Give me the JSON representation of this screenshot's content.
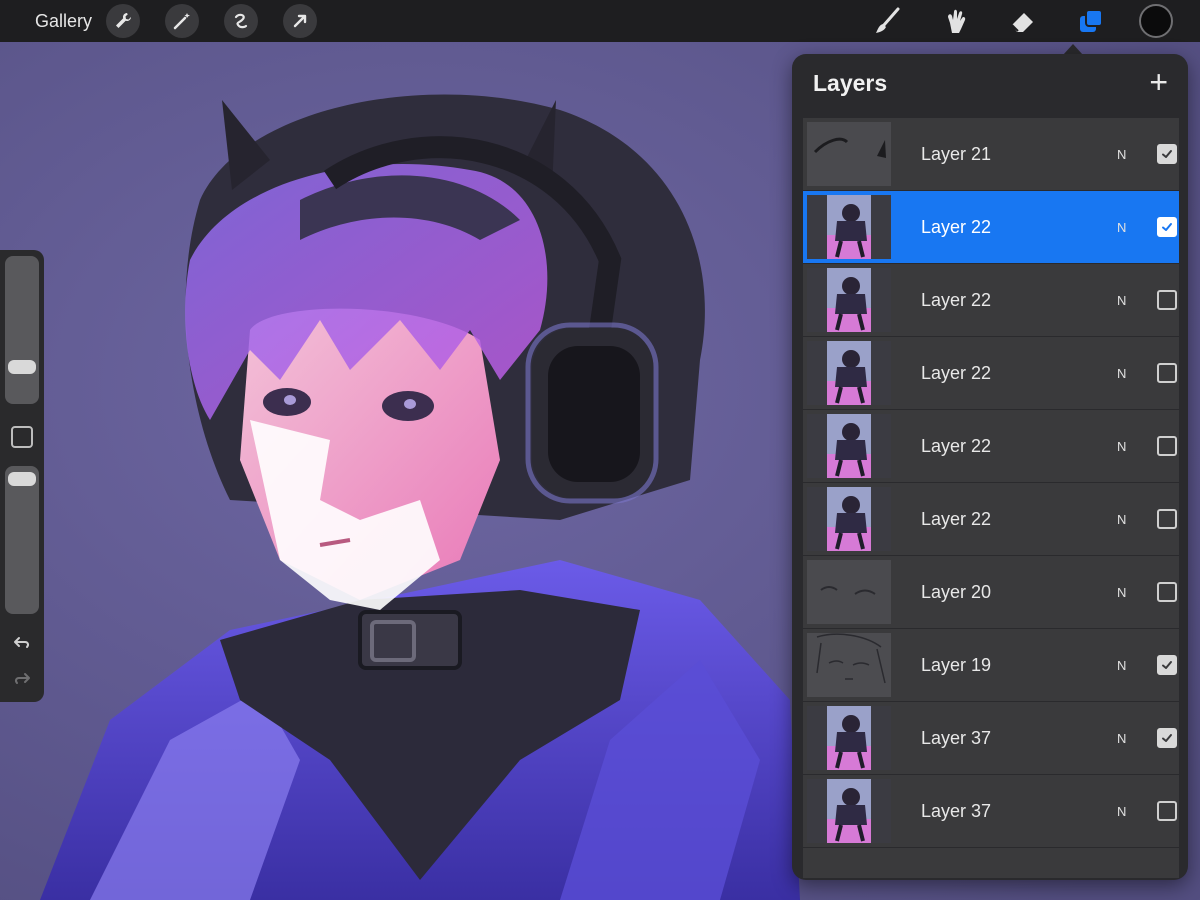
{
  "topbar": {
    "gallery_label": "Gallery",
    "left_tools": [
      "wrench-icon",
      "magic-wand-icon",
      "selection-icon",
      "transform-arrow-icon"
    ],
    "right_tools": [
      "brush-icon",
      "smudge-icon",
      "eraser-icon",
      "layers-icon"
    ],
    "active_tool": "layers-icon",
    "current_color": "#0b0b0c",
    "accent_color": "#1877f2"
  },
  "sidebar": {
    "brush_size_level": 0.36,
    "opacity_level": 0.93,
    "undo_icon": "undo-icon",
    "redo_icon": "redo-icon"
  },
  "layers_panel": {
    "title": "Layers",
    "add_icon": "plus-icon",
    "layers": [
      {
        "name": "Layer 21",
        "blend": "N",
        "visible": true,
        "selected": false,
        "thumb": "horns"
      },
      {
        "name": "Layer 22",
        "blend": "N",
        "visible": true,
        "selected": true,
        "thumb": "figure"
      },
      {
        "name": "Layer 22",
        "blend": "N",
        "visible": false,
        "selected": false,
        "thumb": "figure"
      },
      {
        "name": "Layer 22",
        "blend": "N",
        "visible": false,
        "selected": false,
        "thumb": "figure"
      },
      {
        "name": "Layer 22",
        "blend": "N",
        "visible": false,
        "selected": false,
        "thumb": "figure"
      },
      {
        "name": "Layer 22",
        "blend": "N",
        "visible": false,
        "selected": false,
        "thumb": "figure"
      },
      {
        "name": "Layer 20",
        "blend": "N",
        "visible": false,
        "selected": false,
        "thumb": "eyes"
      },
      {
        "name": "Layer 19",
        "blend": "N",
        "visible": true,
        "selected": false,
        "thumb": "sketch"
      },
      {
        "name": "Layer 37",
        "blend": "N",
        "visible": true,
        "selected": false,
        "thumb": "figure"
      },
      {
        "name": "Layer 37",
        "blend": "N",
        "visible": false,
        "selected": false,
        "thumb": "figure"
      }
    ]
  }
}
